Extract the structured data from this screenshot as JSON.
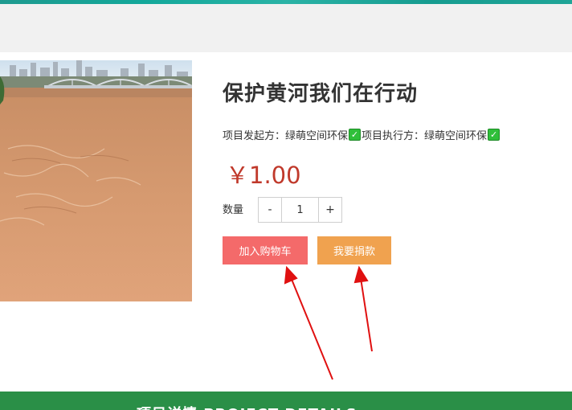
{
  "product": {
    "title": "保护黄河我们在行动",
    "initiator_label": "项目发起方：",
    "initiator_name": "绿萌空间环保",
    "executor_label": "项目执行方：",
    "executor_name": "绿萌空间环保",
    "verified_glyph": "✓",
    "price": "￥1.00"
  },
  "quantity": {
    "label": "数量",
    "minus": "-",
    "value": "1",
    "plus": "+"
  },
  "actions": {
    "add_to_cart": "加入购物车",
    "donate": "我要捐款"
  },
  "section": {
    "title": "项目详情 PROJECT DETAILS"
  },
  "colors": {
    "price": "#c0392b",
    "cart_button": "#f46a6a",
    "donate_button": "#f0a24f",
    "footer_bar": "#2a8f47",
    "annotation_arrow": "#e01010"
  }
}
